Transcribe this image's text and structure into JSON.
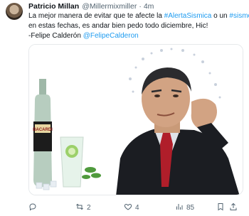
{
  "tweet": {
    "author_name": "Patricio Millan",
    "handle": "@Millermixmiller",
    "separator": "·",
    "time": "4m",
    "lines": [
      [
        {
          "text": "La mejor manera de evitar que te afecte la ",
          "link": false
        },
        {
          "text": "#AlertaSismica",
          "link": true
        },
        {
          "text": " o un ",
          "link": false
        },
        {
          "text": "#sismo",
          "link": true
        }
      ],
      [
        {
          "text": "en estas fechas, es andar bien pedo todo diciembre, Hic!",
          "link": false
        }
      ],
      [
        {
          "text": "-Felipe Calderón ",
          "link": false
        },
        {
          "text": "@FelipeCalderon",
          "link": true
        }
      ]
    ],
    "media": {
      "bottle_label": "BACARDI"
    },
    "actions": {
      "reply": {
        "icon": "reply-icon",
        "count": ""
      },
      "retweet": {
        "icon": "retweet-icon",
        "count": "2"
      },
      "like": {
        "icon": "heart-icon",
        "count": "4"
      },
      "views": {
        "icon": "views-icon",
        "count": "85"
      },
      "share": {
        "icon": "share-icon",
        "count": ""
      }
    }
  },
  "colors": {
    "link": "#1d9bf0",
    "muted": "#536471",
    "text": "#0f1419"
  }
}
